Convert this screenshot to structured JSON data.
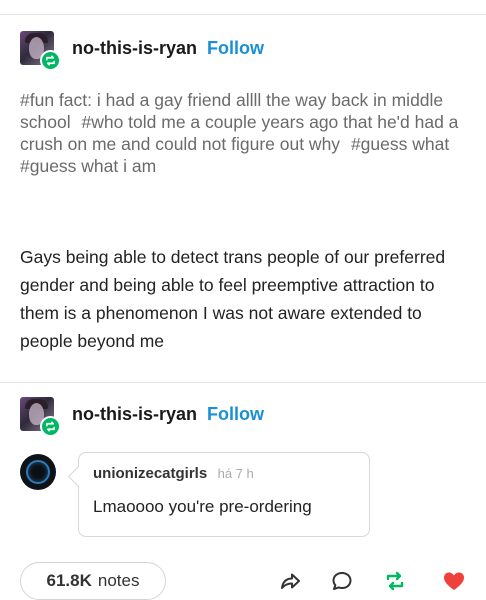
{
  "post": {
    "username": "no-this-is-ryan",
    "follow_label": "Follow",
    "tags": [
      "#fun fact: i had a gay friend allll the way back in middle school",
      "#who told me a couple years ago that he'd had a crush on me and could not figure out why",
      "#guess what",
      "#guess what i am"
    ],
    "body": "Gays being able to detect trans people of our preferred gender and being able to feel preemptive attraction to them is a phenomenon I was not aware extended to people beyond me"
  },
  "reply_post": {
    "username": "no-this-is-ryan",
    "follow_label": "Follow",
    "comment": {
      "username": "unionizecatgirls",
      "time": "há 7 h",
      "text": "Lmaoooo you're pre-ordering"
    }
  },
  "footer": {
    "notes_count": "61.8K",
    "notes_label": "notes"
  },
  "colors": {
    "follow": "#1a8fd6",
    "reblog_green": "#00b862",
    "like_red": "#f0403c"
  },
  "icons": [
    "reblog-badge-icon",
    "share-icon",
    "reply-icon",
    "reblog-icon",
    "heart-icon"
  ]
}
